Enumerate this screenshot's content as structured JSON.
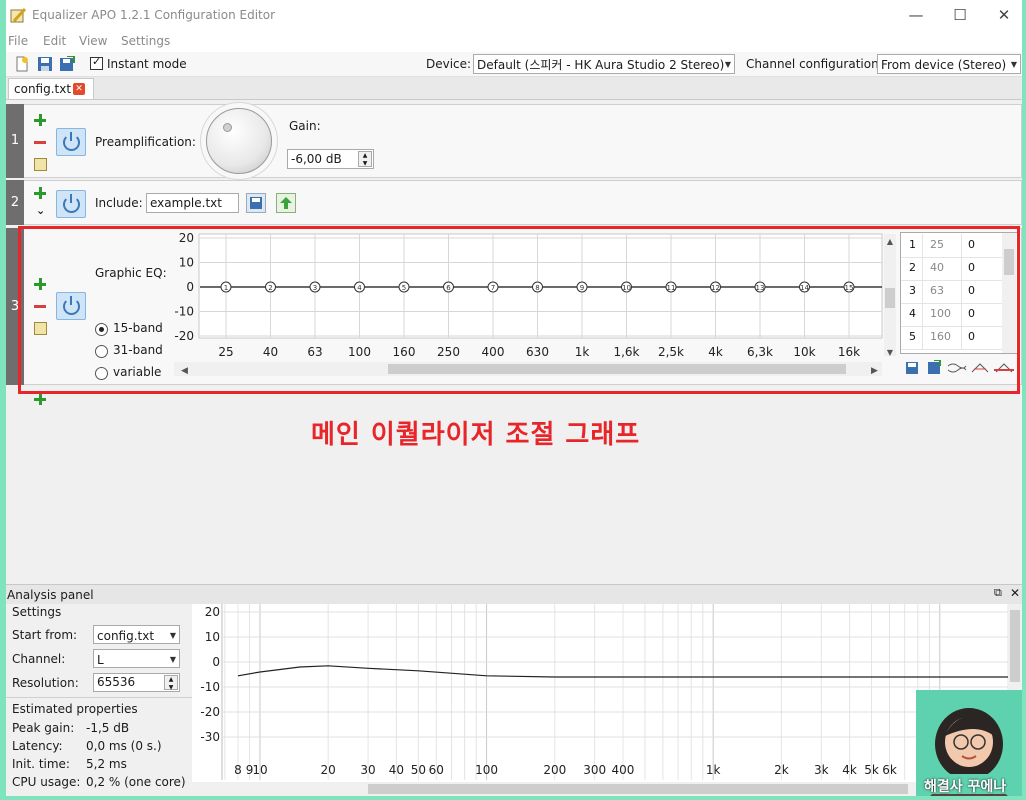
{
  "window": {
    "title": "Equalizer APO 1.2.1 Configuration Editor",
    "controls": {
      "minimize": "—",
      "maximize": "☐",
      "close": "✕"
    }
  },
  "menu": {
    "items": [
      "File",
      "Edit",
      "View",
      "Settings"
    ]
  },
  "toolbar": {
    "instant_mode_label": "Instant mode",
    "instant_mode_checked": true,
    "device_label": "Device:",
    "device_value": "Default (스피커 - HK Aura Studio 2 Stereo)",
    "channel_config_label": "Channel configuration:",
    "channel_config_value": "From device (Stereo)"
  },
  "tabs": [
    {
      "label": "config.txt",
      "close": "✕"
    }
  ],
  "sections": {
    "preamp": {
      "number": "1",
      "label": "Preamplification:",
      "gain_label": "Gain:",
      "gain_value": "-6,00 dB"
    },
    "include": {
      "number": "2",
      "label": "Include:",
      "file": "example.txt",
      "chevron": "⌄"
    },
    "graphic_eq": {
      "number": "3",
      "label": "Graphic EQ:",
      "bands": [
        "15-band",
        "31-band",
        "variable"
      ],
      "selected_band": "15-band",
      "y_ticks": [
        "20",
        "10",
        "0",
        "-10",
        "-20"
      ],
      "freq_labels": [
        "25",
        "40",
        "63",
        "100",
        "160",
        "250",
        "400",
        "630",
        "1k",
        "1,6k",
        "2,5k",
        "4k",
        "6,3k",
        "10k",
        "16k"
      ],
      "node_gains": [
        0,
        0,
        0,
        0,
        0,
        0,
        0,
        0,
        0,
        0,
        0,
        0,
        0,
        0,
        0
      ],
      "table": [
        {
          "idx": "1",
          "freq": "25",
          "gain": "0"
        },
        {
          "idx": "2",
          "freq": "40",
          "gain": "0"
        },
        {
          "idx": "3",
          "freq": "63",
          "gain": "0"
        },
        {
          "idx": "4",
          "freq": "100",
          "gain": "0"
        },
        {
          "idx": "5",
          "freq": "160",
          "gain": "0"
        }
      ]
    }
  },
  "annotation": "메인 이퀄라이저 조절 그래프",
  "analysis": {
    "title": "Analysis panel",
    "settings_label": "Settings",
    "start_from_label": "Start from:",
    "start_from_value": "config.txt",
    "channel_label": "Channel:",
    "channel_value": "L",
    "resolution_label": "Resolution:",
    "resolution_value": "65536",
    "estimated_label": "Estimated properties",
    "peak_gain_label": "Peak gain:",
    "peak_gain_value": "-1,5 dB",
    "latency_label": "Latency:",
    "latency_value": "0,0 ms (0 s.)",
    "init_time_label": "Init. time:",
    "init_time_value": "5,2 ms",
    "cpu_usage_label": "CPU usage:",
    "cpu_usage_value": "0,2 % (one core)",
    "y_ticks": [
      "20",
      "10",
      "0",
      "-10",
      "-20",
      "-30"
    ],
    "x_labels": [
      "8",
      "9",
      "10",
      "20",
      "30",
      "40",
      "50",
      "60",
      "100",
      "200",
      "300",
      "400",
      "1k",
      "2k",
      "3k",
      "4k",
      "5k",
      "6k",
      "1"
    ]
  },
  "chart_data": {
    "type": "line",
    "title": "",
    "xlabel": "",
    "ylabel": "",
    "x": [
      8,
      10,
      15,
      20,
      30,
      50,
      100,
      200,
      1000,
      5000,
      20000
    ],
    "series": [
      {
        "values": [
          -5.5,
          -4,
          -2,
          -1.5,
          -2.5,
          -3.5,
          -5.5,
          -6,
          -6,
          -6,
          -6
        ]
      }
    ],
    "ylim": [
      -30,
      20
    ],
    "x_scale": "log",
    "grid": true
  },
  "avatar_caption": "해결사 꾸에나"
}
